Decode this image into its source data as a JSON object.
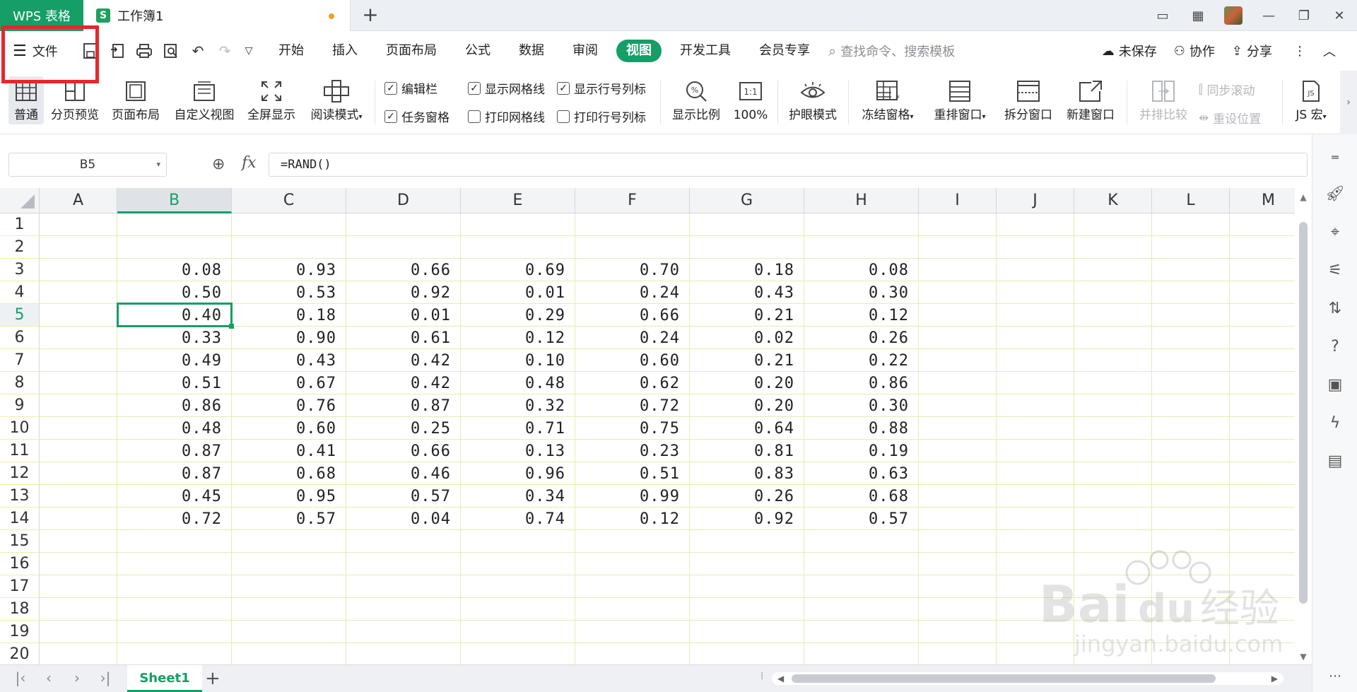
{
  "tabbar": {
    "app_label": "WPS 表格",
    "doc_icon": "S",
    "doc_title": "工作簿1",
    "new_tab": "+",
    "window_controls": [
      "1⃞",
      "▦",
      "—",
      "❐",
      "✕"
    ]
  },
  "menu": {
    "file_label": "文件",
    "tabs": [
      "开始",
      "插入",
      "页面布局",
      "公式",
      "数据",
      "审阅",
      "视图",
      "开发工具",
      "会员专享"
    ],
    "active_tab": "视图",
    "search_placeholder": "查找命令、搜索模板",
    "unsaved": "未保存",
    "collab": "协作",
    "share": "分享"
  },
  "ribbon": {
    "normal": "普通",
    "page_break_preview": "分页预览",
    "page_layout": "页面布局",
    "custom_view": "自定义视图",
    "fullscreen": "全屏显示",
    "reading_mode": "阅读模式",
    "cb_formula_bar": "编辑栏",
    "cb_show_gridlines": "显示网格线",
    "cb_show_headers": "显示行号列标",
    "cb_task_pane": "任务窗格",
    "cb_print_gridlines": "打印网格线",
    "cb_print_headers": "打印行号列标",
    "zoom": "显示比例",
    "zoom_100": "100%",
    "eye_mode": "护眼模式",
    "freeze_panes": "冻结窗格",
    "arrange_windows": "重排窗口",
    "split_window": "拆分窗口",
    "new_window": "新建窗口",
    "side_by_side": "并排比较",
    "sync_scroll": "同步滚动",
    "reset_position": "重设位置",
    "js_macro": "JS 宏"
  },
  "formula_bar": {
    "cell_ref": "B5",
    "formula": "=RAND()"
  },
  "grid": {
    "columns": [
      "A",
      "B",
      "C",
      "D",
      "E",
      "F",
      "G",
      "H",
      "I",
      "J",
      "K",
      "L",
      "M"
    ],
    "rows": [
      "1",
      "2",
      "3",
      "4",
      "5",
      "6",
      "7",
      "8",
      "9",
      "10",
      "11",
      "12",
      "13",
      "14",
      "15",
      "16",
      "17",
      "18",
      "19",
      "20"
    ],
    "selected_column": "B",
    "selected_row": "5",
    "data_start_row": 3,
    "data": [
      [
        "0.08",
        "0.93",
        "0.66",
        "0.69",
        "0.70",
        "0.18",
        "0.08"
      ],
      [
        "0.50",
        "0.53",
        "0.92",
        "0.01",
        "0.24",
        "0.43",
        "0.30"
      ],
      [
        "0.40",
        "0.18",
        "0.01",
        "0.29",
        "0.66",
        "0.21",
        "0.12"
      ],
      [
        "0.33",
        "0.90",
        "0.61",
        "0.12",
        "0.24",
        "0.02",
        "0.26"
      ],
      [
        "0.49",
        "0.43",
        "0.42",
        "0.10",
        "0.60",
        "0.21",
        "0.22"
      ],
      [
        "0.51",
        "0.67",
        "0.42",
        "0.48",
        "0.62",
        "0.20",
        "0.86"
      ],
      [
        "0.86",
        "0.76",
        "0.87",
        "0.32",
        "0.72",
        "0.20",
        "0.30"
      ],
      [
        "0.48",
        "0.60",
        "0.25",
        "0.71",
        "0.75",
        "0.64",
        "0.88"
      ],
      [
        "0.87",
        "0.41",
        "0.66",
        "0.13",
        "0.23",
        "0.81",
        "0.19"
      ],
      [
        "0.87",
        "0.68",
        "0.46",
        "0.96",
        "0.51",
        "0.83",
        "0.63"
      ],
      [
        "0.45",
        "0.95",
        "0.57",
        "0.34",
        "0.99",
        "0.26",
        "0.68"
      ],
      [
        "0.72",
        "0.57",
        "0.04",
        "0.74",
        "0.12",
        "0.92",
        "0.57"
      ]
    ]
  },
  "bottom": {
    "sheet_name": "Sheet1"
  },
  "watermark": {
    "brand": "Bai",
    "brand2": "du",
    "cn": "经验",
    "url": "jingyan.baidu.com"
  },
  "colors": {
    "accent": "#159e66",
    "highlight": "#e8262a",
    "gridline": "#e6ecb0"
  }
}
